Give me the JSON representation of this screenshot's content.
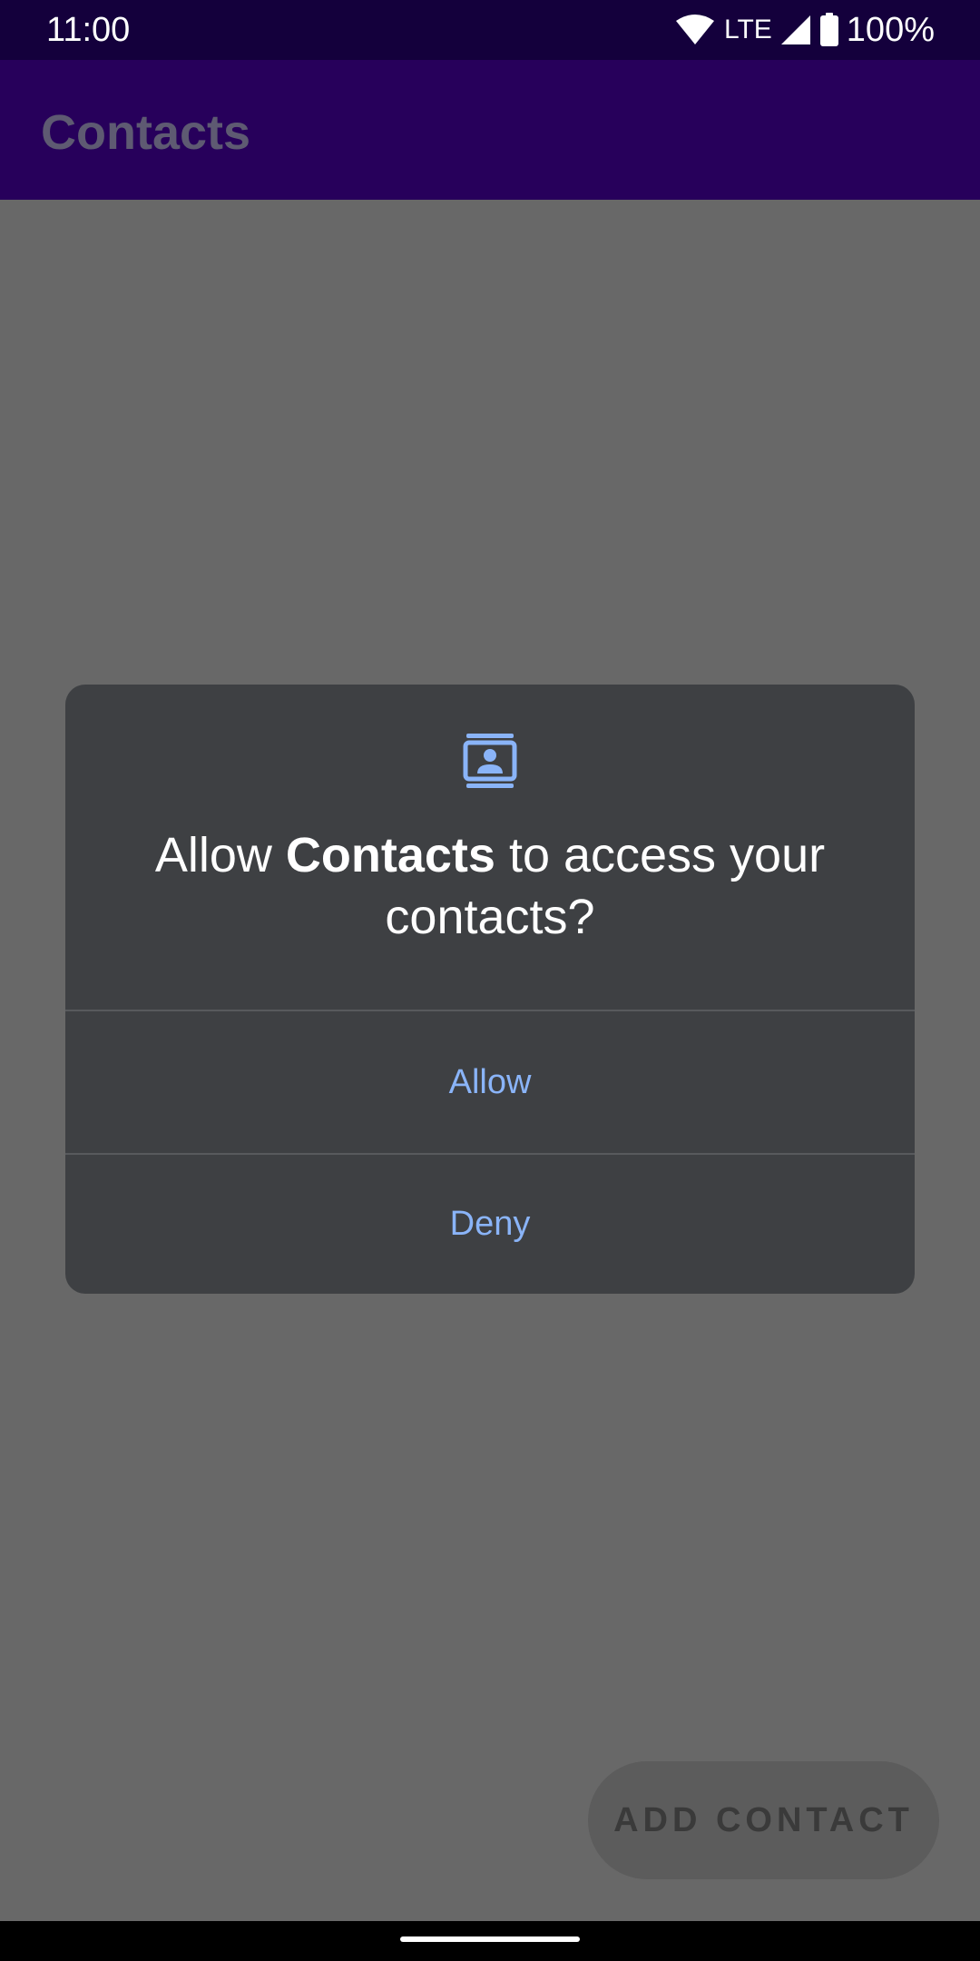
{
  "status_bar": {
    "time": "11:00",
    "network": "LTE",
    "battery": "100%",
    "icons": [
      "wifi-icon",
      "cellular-signal-icon",
      "battery-icon"
    ]
  },
  "app_bar": {
    "title": "Contacts"
  },
  "fab": {
    "label": "ADD CONTACT"
  },
  "dialog": {
    "icon": "contacts-icon",
    "title_prefix": "Allow ",
    "title_app": "Contacts",
    "title_suffix": " to access your contacts?",
    "allow_label": "Allow",
    "deny_label": "Deny"
  },
  "colors": {
    "status_bar": "#14003c",
    "app_bar": "#27005b",
    "scrim": "#686868",
    "dialog_bg": "#3e4043",
    "dialog_accent": "#8ab4f8"
  }
}
